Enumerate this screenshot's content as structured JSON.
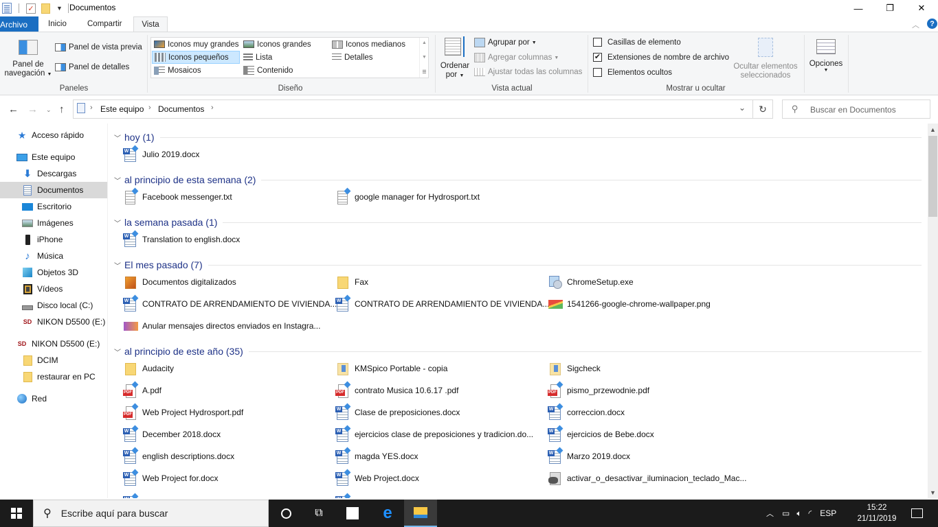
{
  "window": {
    "title": "Documentos",
    "controls": {
      "minimize": "—",
      "maximize": "❐",
      "close": "✕"
    }
  },
  "ribbon_tabs": [
    {
      "label": "Archivo"
    },
    {
      "label": "Inicio"
    },
    {
      "label": "Compartir"
    },
    {
      "label": "Vista",
      "active": true
    }
  ],
  "ribbon": {
    "paneles": {
      "label": "Paneles",
      "nav_pane": "Panel de navegación",
      "nav_pane_line1": "Panel de",
      "nav_pane_line2": "navegación",
      "preview_pane": "Panel de vista previa",
      "details_pane": "Panel de detalles"
    },
    "diseno": {
      "label": "Diseño",
      "options": [
        {
          "label": "Iconos muy grandes",
          "selected": false
        },
        {
          "label": "Iconos grandes",
          "selected": false
        },
        {
          "label": "Iconos medianos",
          "selected": false
        },
        {
          "label": "Iconos pequeños",
          "selected": true
        },
        {
          "label": "Lista",
          "selected": false
        },
        {
          "label": "Detalles",
          "selected": false
        },
        {
          "label": "Mosaicos",
          "selected": false
        },
        {
          "label": "Contenido",
          "selected": false
        }
      ]
    },
    "vista_actual": {
      "label": "Vista actual",
      "sort_line1": "Ordenar",
      "sort_line2": "por",
      "group_by": "Agrupar por",
      "add_columns": "Agregar columnas",
      "fit_columns": "Ajustar todas las columnas"
    },
    "mostrar": {
      "label": "Mostrar u ocultar",
      "item_checkboxes": {
        "label": "Casillas de elemento",
        "checked": false
      },
      "file_extensions": {
        "label": "Extensiones de nombre de archivo",
        "checked": true
      },
      "hidden_items": {
        "label": "Elementos ocultos",
        "checked": false
      },
      "hide_selected_line1": "Ocultar elementos",
      "hide_selected_line2": "seleccionados"
    },
    "options": {
      "label": "Opciones"
    }
  },
  "address_bar": {
    "crumbs": [
      "Este equipo",
      "Documentos"
    ],
    "search_placeholder": "Buscar en Documentos"
  },
  "sidebar": {
    "items": [
      {
        "label": "Acceso rápido",
        "icon": "star-icon",
        "indent": 0
      },
      {
        "label": "Este equipo",
        "icon": "computer-icon",
        "indent": 0
      },
      {
        "label": "Descargas",
        "icon": "download-icon",
        "indent": 1
      },
      {
        "label": "Documentos",
        "icon": "document-icon",
        "indent": 1,
        "selected": true
      },
      {
        "label": "Escritorio",
        "icon": "desktop-icon",
        "indent": 1
      },
      {
        "label": "Imágenes",
        "icon": "pictures-icon",
        "indent": 1
      },
      {
        "label": "iPhone",
        "icon": "phone-icon",
        "indent": 1
      },
      {
        "label": "Música",
        "icon": "music-icon",
        "indent": 1
      },
      {
        "label": "Objetos 3D",
        "icon": "cube-icon",
        "indent": 1
      },
      {
        "label": "Vídeos",
        "icon": "video-icon",
        "indent": 1
      },
      {
        "label": "Disco local (C:)",
        "icon": "drive-icon",
        "indent": 1
      },
      {
        "label": "NIKON D5500 (E:)",
        "icon": "sd-card-icon",
        "indent": 1
      },
      {
        "label": "NIKON D5500 (E:)",
        "icon": "sd-card-icon",
        "indent": 0
      },
      {
        "label": "DCIM",
        "icon": "folder-icon",
        "indent": 1
      },
      {
        "label": "restaurar en PC",
        "icon": "folder-icon",
        "indent": 1
      },
      {
        "label": "Red",
        "icon": "network-icon",
        "indent": 0
      }
    ]
  },
  "groups": [
    {
      "header": "hoy (1)",
      "files": [
        {
          "name": "Julio 2019.docx",
          "type": "docx"
        }
      ]
    },
    {
      "header": "al principio de esta semana (2)",
      "files": [
        {
          "name": "Facebook messenger.txt",
          "type": "txt"
        },
        {
          "name": "google manager for Hydrosport.txt",
          "type": "txt"
        }
      ]
    },
    {
      "header": "la semana pasada (1)",
      "files": [
        {
          "name": "Translation to english.docx",
          "type": "docx"
        }
      ]
    },
    {
      "header": "El mes pasado (7)",
      "files": [
        {
          "name": "Documentos digitalizados",
          "type": "folder-special"
        },
        {
          "name": "Fax",
          "type": "folder"
        },
        {
          "name": "ChromeSetup.exe",
          "type": "exe"
        },
        {
          "name": "CONTRATO DE ARRENDAMIENTO DE VIVIENDA...",
          "type": "docx"
        },
        {
          "name": "CONTRATO DE ARRENDAMIENTO DE VIVIENDA...",
          "type": "docx"
        },
        {
          "name": "1541266-google-chrome-wallpaper.png",
          "type": "png"
        },
        {
          "name": "Anular mensajes directos enviados en Instagra...",
          "type": "image"
        }
      ]
    },
    {
      "header": "al principio de este año (35)",
      "files": [
        {
          "name": "Audacity",
          "type": "folder"
        },
        {
          "name": "KMSpico Portable - copia",
          "type": "folder-blue"
        },
        {
          "name": "Sigcheck",
          "type": "folder-blue"
        },
        {
          "name": "A.pdf",
          "type": "pdf"
        },
        {
          "name": "contrato Musica 10.6.17 .pdf",
          "type": "pdf"
        },
        {
          "name": "pismo_przewodnie.pdf",
          "type": "pdf"
        },
        {
          "name": "Web Project Hydrosport.pdf",
          "type": "pdf"
        },
        {
          "name": "Clase de preposiciones.docx",
          "type": "docx"
        },
        {
          "name": "correccion.docx",
          "type": "docx"
        },
        {
          "name": "December 2018.docx",
          "type": "docx"
        },
        {
          "name": "ejercicios clase de preposiciones y tradicion.do...",
          "type": "docx"
        },
        {
          "name": "ejercicios de Bebe.docx",
          "type": "docx"
        },
        {
          "name": "english descriptions.docx",
          "type": "docx"
        },
        {
          "name": "magda YES.docx",
          "type": "docx"
        },
        {
          "name": "Marzo 2019.docx",
          "type": "docx"
        },
        {
          "name": "Web Project for.docx",
          "type": "docx"
        },
        {
          "name": "Web Project.docx",
          "type": "docx"
        },
        {
          "name": "activar_o_desactivar_iluminacion_teclado_Mac...",
          "type": "gimp"
        }
      ]
    }
  ],
  "taskbar": {
    "search_placeholder": "Escribe aquí para buscar",
    "language": "ESP",
    "time": "15:22",
    "date": "21/11/2019"
  },
  "colors": {
    "accent": "#1a6ec2",
    "group_header": "#1e3287",
    "selection": "#cce8ff",
    "taskbar": "#1b1b1b"
  }
}
